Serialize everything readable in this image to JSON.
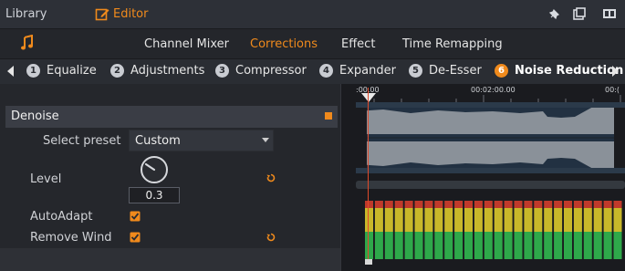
{
  "titlebar": {
    "library_label": "Library",
    "editor_label": "Editor"
  },
  "tabs": [
    {
      "label": "Channel Mixer",
      "active": false
    },
    {
      "label": "Corrections",
      "active": true
    },
    {
      "label": "Effect",
      "active": false
    },
    {
      "label": "Time Remapping",
      "active": false
    }
  ],
  "modules": [
    {
      "num": "1",
      "label": "Equalize",
      "active": false
    },
    {
      "num": "2",
      "label": "Adjustments",
      "active": false
    },
    {
      "num": "3",
      "label": "Compressor",
      "active": false
    },
    {
      "num": "4",
      "label": "Expander",
      "active": false
    },
    {
      "num": "5",
      "label": "De-Esser",
      "active": false
    },
    {
      "num": "6",
      "label": "Noise Reduction",
      "active": true
    }
  ],
  "panel": {
    "title": "Denoise",
    "select_preset_label": "Select preset",
    "preset_value": "Custom",
    "level_label": "Level",
    "level_value": "0.3",
    "autoadapt_label": "AutoAdapt",
    "autoadapt_checked": true,
    "remove_wind_label": "Remove Wind",
    "remove_wind_checked": true
  },
  "timeline": {
    "start_tc": ":00.00",
    "mid_tc": "00:02:00.00",
    "end_tc": "00:("
  },
  "colors": {
    "accent": "#f08a1c",
    "meter_green": "#2ea84a",
    "meter_yellow": "#c8b82a",
    "meter_red": "#c0392b"
  },
  "icons": [
    "music-note-icon",
    "pencil-icon",
    "pin-icon",
    "window-icon",
    "panel-icon",
    "reset-icon",
    "checkbox-icon"
  ]
}
